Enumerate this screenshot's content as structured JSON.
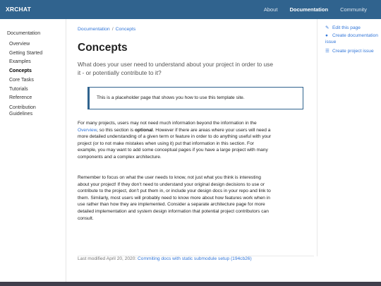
{
  "navbar": {
    "brand": "XRCHAT",
    "links": [
      {
        "label": "About",
        "active": false
      },
      {
        "label": "Documentation",
        "active": true
      },
      {
        "label": "Community",
        "active": false
      }
    ]
  },
  "sidebar": {
    "root": "Documentation",
    "items": [
      {
        "label": "Overview"
      },
      {
        "label": "Getting Started"
      },
      {
        "label": "Examples"
      },
      {
        "label": "Concepts"
      },
      {
        "label": "Core Tasks"
      },
      {
        "label": "Tutorials"
      },
      {
        "label": "Reference"
      },
      {
        "label": "Contribution Guidelines"
      }
    ]
  },
  "breadcrumb": {
    "items": [
      "Documentation",
      "Concepts"
    ],
    "separator": "/"
  },
  "page": {
    "title": "Concepts",
    "lead": "What does your user need to understand about your project in order to use it - or potentially contribute to it?",
    "alert": "This is a placeholder page that shows you how to use this template site.",
    "p1_a": "For many projects, users may not need much information beyond the information in the ",
    "p1_link": "Overview",
    "p1_b": ", so this section is ",
    "p1_bold": "optional",
    "p1_c": ". However if there are areas where your users will need a more detailed understanding of a given term or feature in order to do anything useful with your project (or to not make mistakes when using it) put that information in this section. For example, you may want to add some conceptual pages if you have a large project with many components and a complex architecture.",
    "p2": "Remember to focus on what the user needs to know, not just what you think is interesting about your project! If they don’t need to understand your original design decisions to use or contribute to the project, don’t put them in, or include your design docs in your repo and link to them. Similarly, most users will probably need to know more about how features work when in use rather than how they are implemented. Consider a separate architecture page for more detailed implementation and system design information that potential project contributors can consult.",
    "last_modified_prefix": "Last modified April 20, 2020: ",
    "last_modified_link": "Commiting docs with static submodule setup (194cb26)"
  },
  "actions": {
    "edit": "Edit this page",
    "create_doc_issue": "Create documentation issue",
    "create_project_issue": "Create project issue"
  },
  "colors": {
    "navbar": "#30638e",
    "link": "#3176d9",
    "footer": "#403f4c"
  }
}
